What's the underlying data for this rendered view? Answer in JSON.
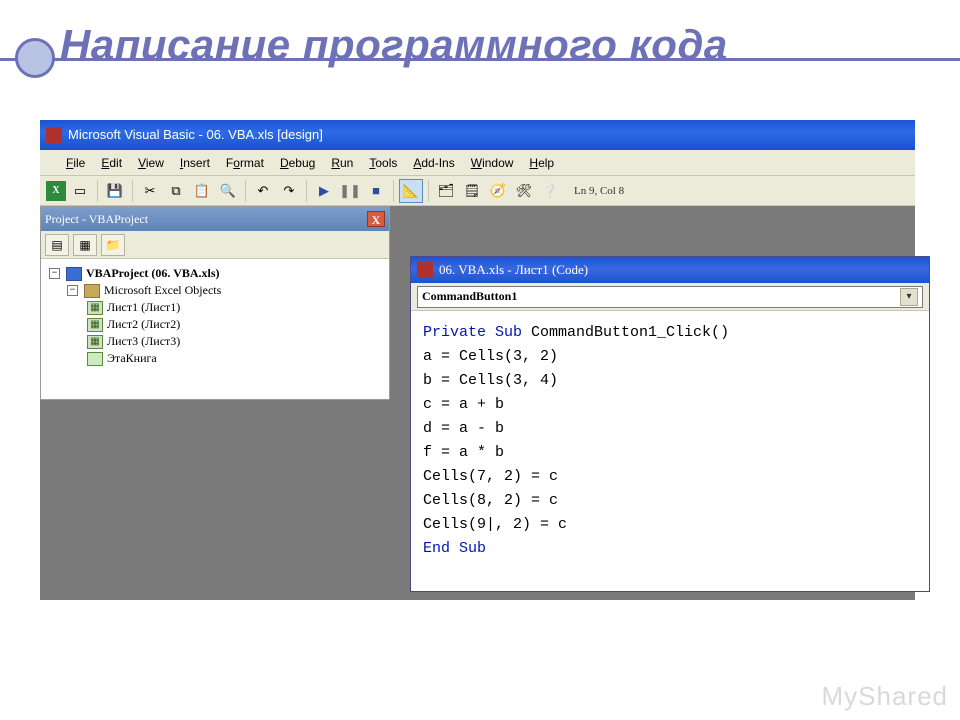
{
  "slide": {
    "title": "Написание программного кода",
    "watermark": "MyShared"
  },
  "mainWindow": {
    "title": "Microsoft Visual Basic - 06. VBA.xls [design]"
  },
  "menubar": {
    "items": [
      "File",
      "Edit",
      "View",
      "Insert",
      "Format",
      "Debug",
      "Run",
      "Tools",
      "Add-Ins",
      "Window",
      "Help"
    ]
  },
  "toolbar": {
    "cursor": "Ln 9, Col 8"
  },
  "projectExplorer": {
    "title": "Project - VBAProject",
    "root": "VBAProject (06. VBA.xls)",
    "folder": "Microsoft Excel Objects",
    "items": [
      "Лист1 (Лист1)",
      "Лист2 (Лист2)",
      "Лист3 (Лист3)",
      "ЭтаКнига"
    ]
  },
  "codeWindow": {
    "title": "06. VBA.xls - Лист1 (Code)",
    "objectDropdown": "CommandButton1",
    "lines": [
      {
        "kw": "Private Sub",
        "rest": " CommandButton1_Click()"
      },
      {
        "kw": "",
        "rest": "a = Cells(3, 2)"
      },
      {
        "kw": "",
        "rest": "b = Cells(3, 4)"
      },
      {
        "kw": "",
        "rest": "c = a + b"
      },
      {
        "kw": "",
        "rest": "d = a - b"
      },
      {
        "kw": "",
        "rest": "f = a * b"
      },
      {
        "kw": "",
        "rest": "Cells(7, 2) = c"
      },
      {
        "kw": "",
        "rest": "Cells(8, 2) = c"
      },
      {
        "kw": "",
        "rest": "Cells(9, 2) = c",
        "caretAfter": 7
      },
      {
        "kw": "End Sub",
        "rest": ""
      }
    ]
  }
}
